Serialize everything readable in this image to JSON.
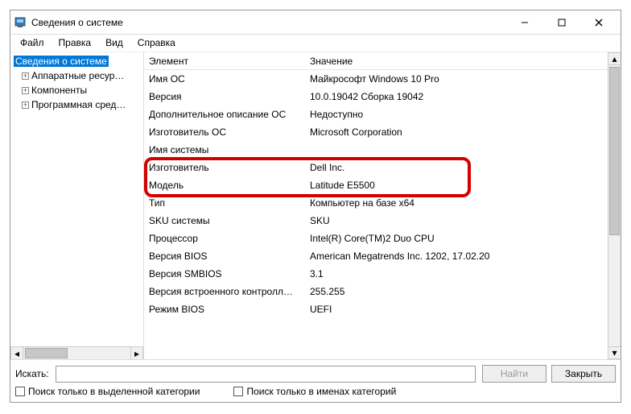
{
  "titlebar": {
    "title": "Сведения о системе"
  },
  "menu": {
    "file": "Файл",
    "edit": "Правка",
    "view": "Вид",
    "help": "Справка"
  },
  "tree": {
    "root": "Сведения о системе",
    "hardware": "Аппаратные ресур…",
    "components": "Компоненты",
    "software": "Программная сред…"
  },
  "detail": {
    "header_key": "Элемент",
    "header_val": "Значение",
    "rows": [
      {
        "k": "Имя ОС",
        "v": "Майкрософт Windows 10 Pro"
      },
      {
        "k": "Версия",
        "v": "10.0.19042 Сборка 19042"
      },
      {
        "k": "Дополнительное описание ОС",
        "v": "Недоступно"
      },
      {
        "k": "Изготовитель ОС",
        "v": "Microsoft Corporation"
      },
      {
        "k": "Имя системы",
        "v": ""
      },
      {
        "k": "Изготовитель",
        "v": "Dell Inc."
      },
      {
        "k": "Модель",
        "v": "Latitude E5500"
      },
      {
        "k": "Тип",
        "v": "Компьютер на базе x64"
      },
      {
        "k": "SKU системы",
        "v": "SKU"
      },
      {
        "k": "Процессор",
        "v": "Intel(R) Core(TM)2 Duo CPU"
      },
      {
        "k": "Версия BIOS",
        "v": "American Megatrends Inc. 1202, 17.02.20"
      },
      {
        "k": "Версия SMBIOS",
        "v": "3.1"
      },
      {
        "k": "Версия встроенного контролл…",
        "v": "255.255"
      },
      {
        "k": "Режим BIOS",
        "v": "UEFI"
      }
    ]
  },
  "search": {
    "label": "Искать:",
    "placeholder": "",
    "find_btn": "Найти",
    "close_btn": "Закрыть",
    "cb_selected_only": "Поиск только в выделенной категории",
    "cb_names_only": "Поиск только в именах категорий"
  }
}
